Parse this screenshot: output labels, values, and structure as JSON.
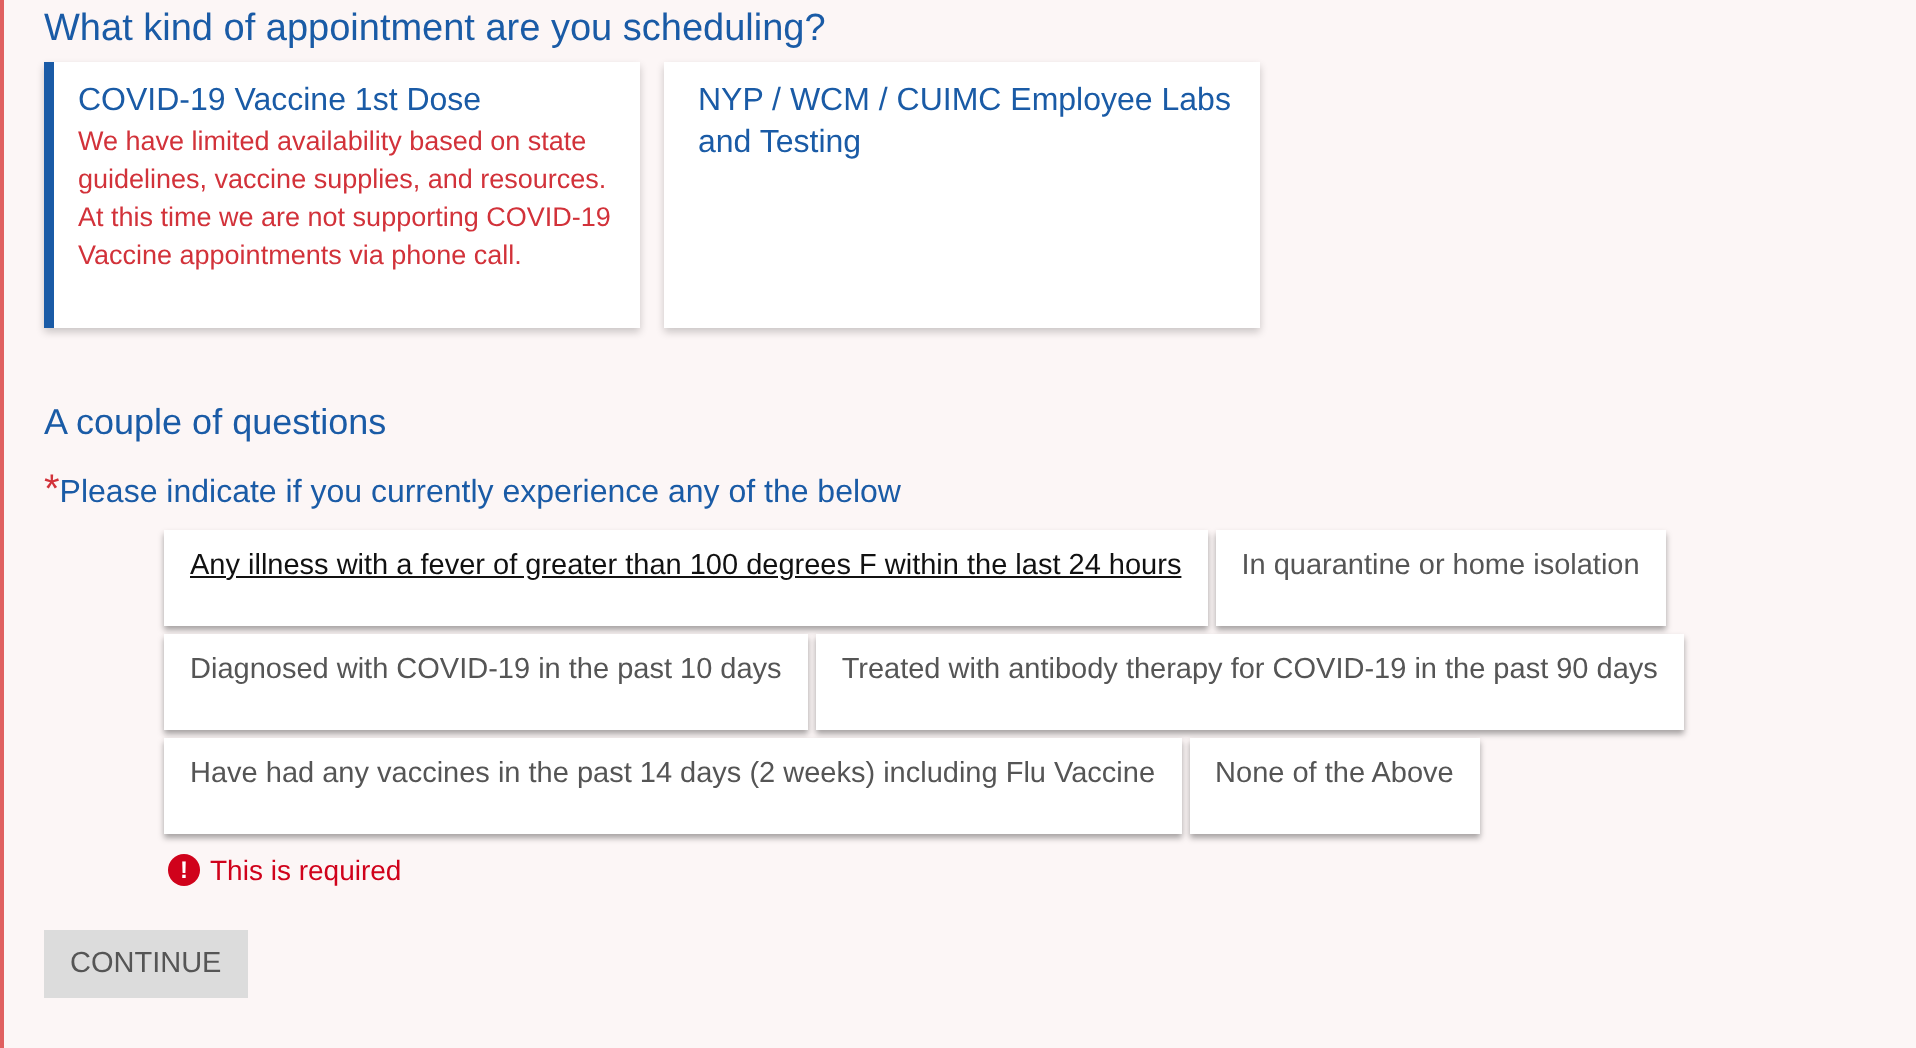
{
  "heading": "What kind of appointment are you scheduling?",
  "appointment_types": [
    {
      "title": "COVID-19 Vaccine 1st Dose",
      "note": "We have limited availability based on state guidelines, vaccine supplies, and resources. At this time we are not supporting COVID-19 Vaccine appointments via phone call.",
      "selected": true
    },
    {
      "title": "NYP / WCM / CUIMC Employee Labs and Testing",
      "selected": false
    }
  ],
  "questions_heading": "A couple of questions",
  "question": {
    "required_mark": "*",
    "label": "Please indicate if you currently experience any of the below"
  },
  "options": [
    [
      {
        "label": "Any illness with a fever of greater than 100 degrees F within the last 24 hours",
        "highlighted": true
      },
      {
        "label": "In quarantine or home isolation",
        "highlighted": false
      }
    ],
    [
      {
        "label": "Diagnosed with COVID-19 in the past 10 days",
        "highlighted": false
      },
      {
        "label": "Treated with antibody therapy for COVID-19 in the past 90 days",
        "highlighted": false
      }
    ],
    [
      {
        "label": "Have had any vaccines in the past 14 days (2 weeks) including Flu Vaccine",
        "highlighted": false
      },
      {
        "label": "None of the Above",
        "highlighted": false
      }
    ]
  ],
  "error": {
    "icon": "!",
    "message": "This is required"
  },
  "continue_button": "CONTINUE"
}
